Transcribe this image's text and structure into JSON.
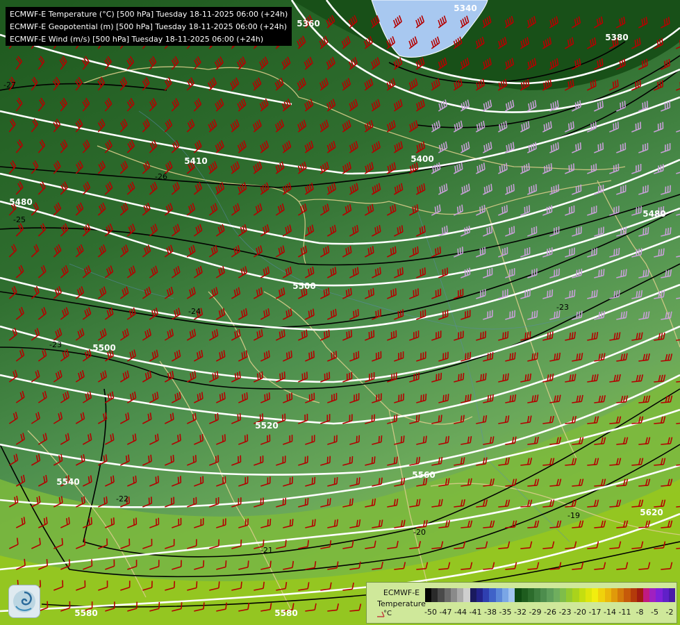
{
  "title_lines": [
    "ECMWF-E Temperature (°C) [500 hPa] Tuesday 18-11-2025 06:00 (+24h)",
    "ECMWF-E Geopotential (m) [500 hPa] Tuesday 18-11-2025 06:00 (+24h)",
    "ECMWF-E Wind (m/s) [500 hPa] Tuesday 18-11-2025 06:00 (+24h)"
  ],
  "geopotential_labels": [
    "5340",
    "5360",
    "5380",
    "5400",
    "5410",
    "5480",
    "5480",
    "5500",
    "5500",
    "5520",
    "5540",
    "5560",
    "5580",
    "5580",
    "5620"
  ],
  "temperature_labels": [
    "-27",
    "-26",
    "-25",
    "-24",
    "-23",
    "-23",
    "-22",
    "-21",
    "-20",
    "-19"
  ],
  "legend": {
    "model": "ECMWF-E",
    "variable": "Temperature",
    "unit": "°C",
    "ticks": [
      "-50",
      "-47",
      "-44",
      "-41",
      "-38",
      "-35",
      "-32",
      "-29",
      "-26",
      "-23",
      "-20",
      "-17",
      "-14",
      "-11",
      "-8",
      "-5",
      "-2"
    ],
    "colors": [
      "#050505",
      "#2a2a2a",
      "#4a4a4a",
      "#6a6a6a",
      "#8a8a8a",
      "#aaaaaa",
      "#cfcfcf",
      "#1a1a5e",
      "#23238a",
      "#2f3fb0",
      "#3f62c8",
      "#5a86d8",
      "#7aa6e6",
      "#a2c4f0",
      "#0f4a12",
      "#1e5c1e",
      "#2c6c2c",
      "#3d7d3d",
      "#4d8d4d",
      "#5e9e5a",
      "#6fae5e",
      "#7fbd4a",
      "#93c92e",
      "#a9d31c",
      "#c4de10",
      "#dde60c",
      "#f2ee0e",
      "#f0d20c",
      "#eab80c",
      "#e09a0a",
      "#d47a0a",
      "#c65a0a",
      "#b43a0a",
      "#a01c10",
      "#c01a80",
      "#a020c0",
      "#8020d8",
      "#6020c8",
      "#4a1aa8"
    ]
  },
  "colors": {
    "geopotential_isoline": "#ffffff",
    "temperature_isoline": "#000000",
    "wind_barb_cold": "#b40000",
    "wind_barb_strong": "#c8a0d8",
    "borders": "#d8cc8a",
    "rivers": "#5a8ab0",
    "lake": "#a8c8f0"
  }
}
